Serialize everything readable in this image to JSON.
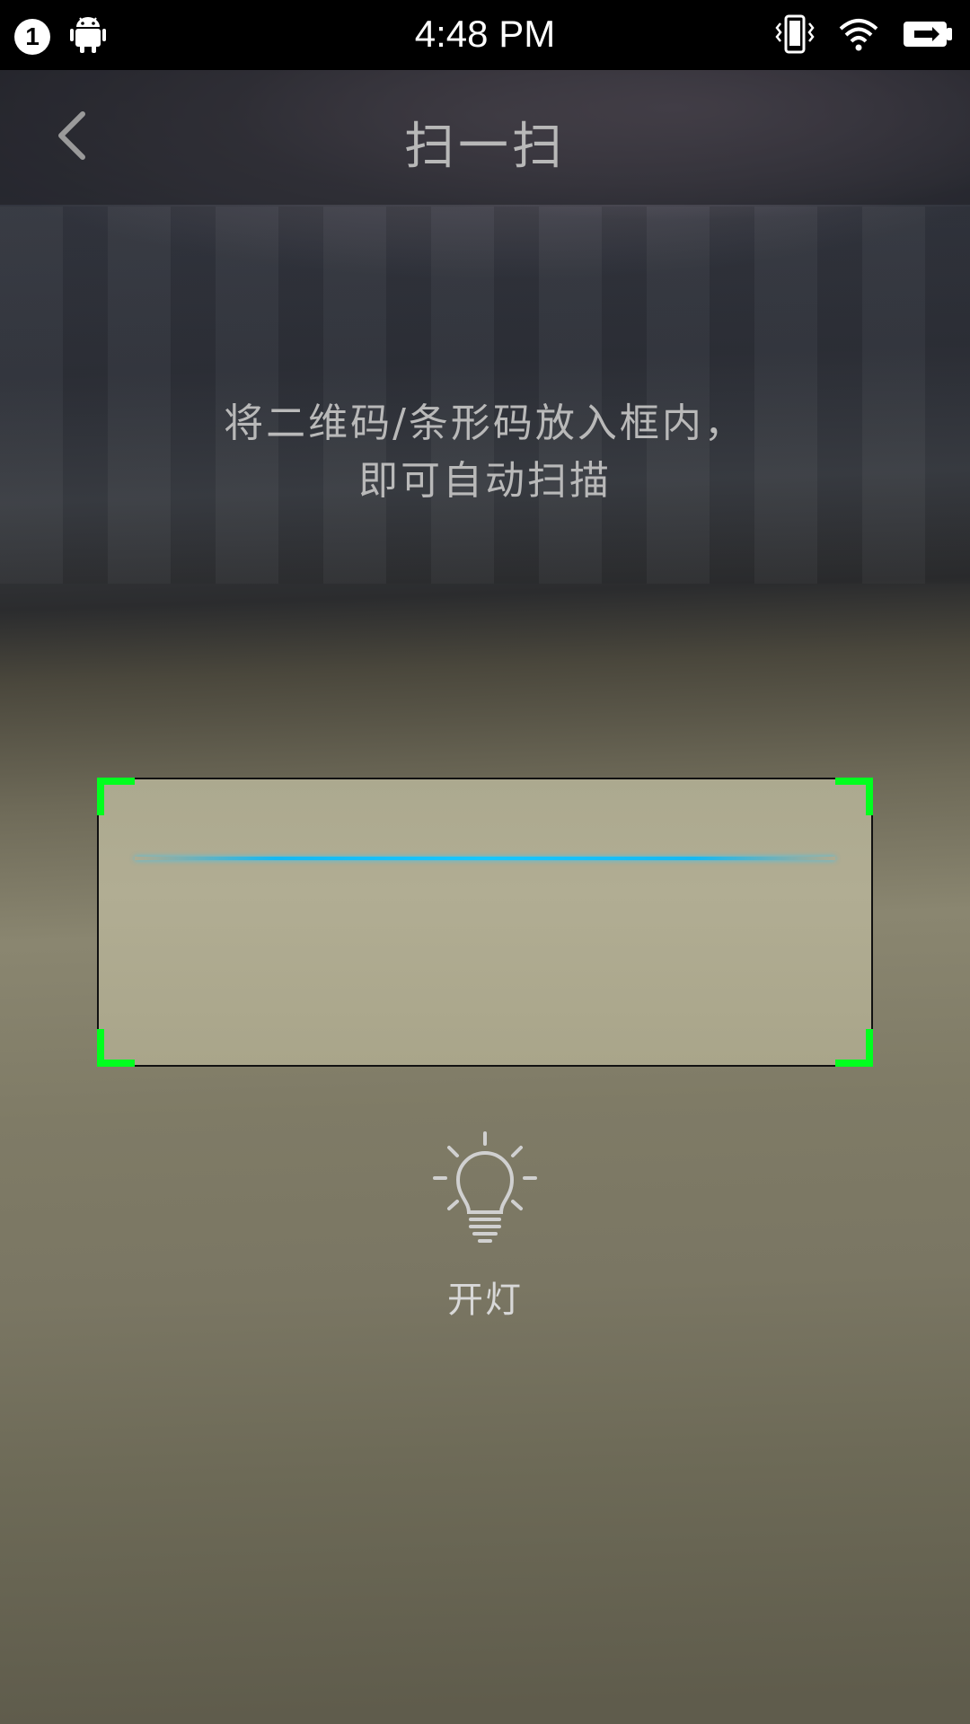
{
  "status_bar": {
    "notification_count": "1",
    "time": "4:48 PM",
    "icons": [
      "android-icon",
      "vibrate-icon",
      "wifi-icon",
      "battery-charging-icon"
    ]
  },
  "toolbar": {
    "title": "扫一扫",
    "back_icon": "chevron-left-icon"
  },
  "hint": {
    "line1": "将二维码/条形码放入框内，",
    "line2": "即可自动扫描"
  },
  "scanner": {
    "corner_color": "#00ff1f",
    "scan_line_color": "#18c6ff"
  },
  "light_toggle": {
    "icon": "lightbulb-icon",
    "label": "开灯"
  }
}
